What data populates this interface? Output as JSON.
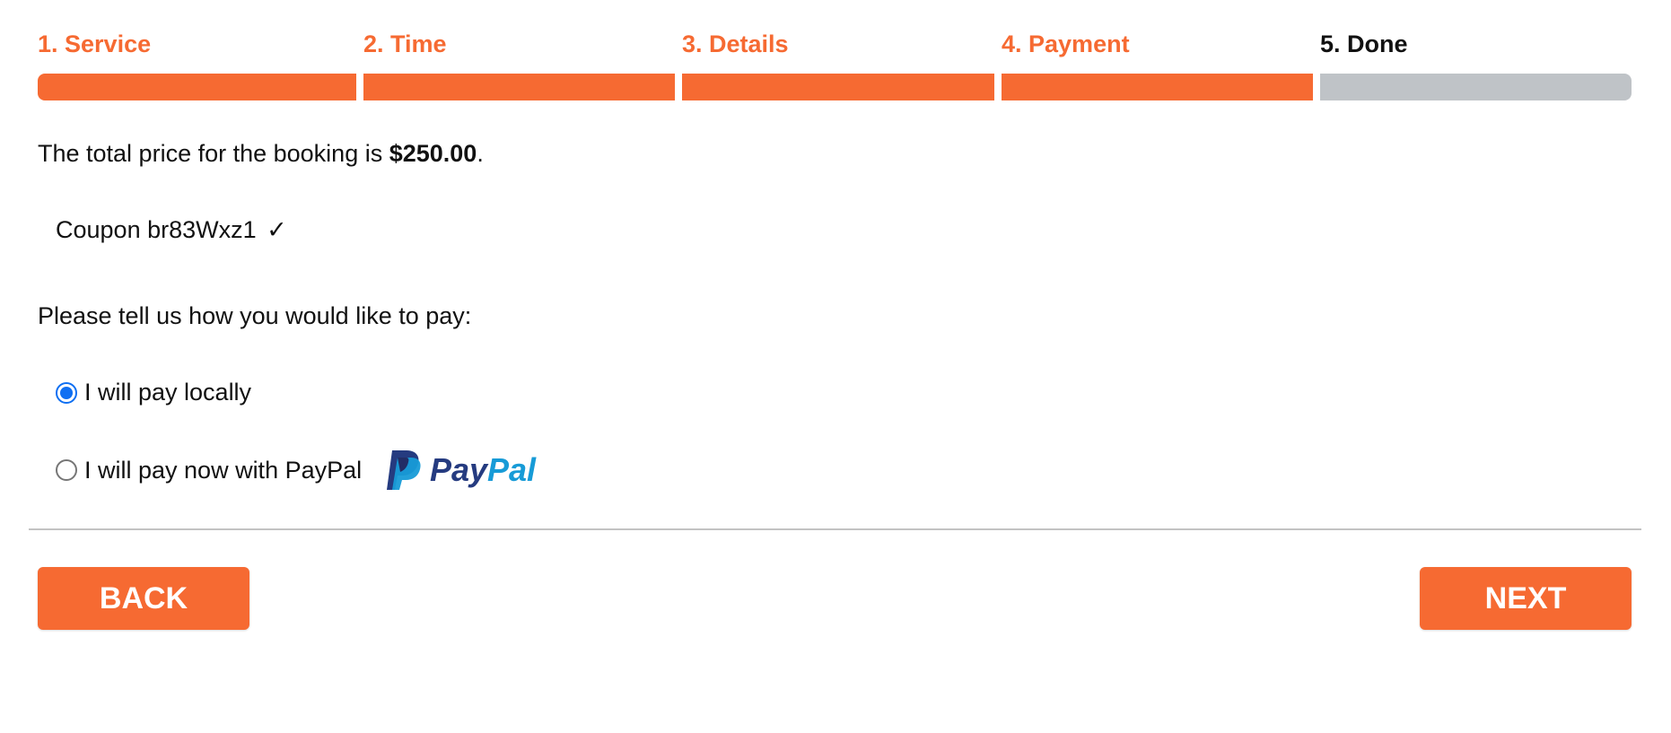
{
  "colors": {
    "accent": "#f66a32",
    "inactive_bar": "#bfc3c7",
    "done_label": "#111111",
    "radio_checked": "#0f6ff2",
    "paypal_dark": "#253b80",
    "paypal_light": "#179bd7"
  },
  "steps": [
    {
      "label": "1. Service",
      "state": "complete"
    },
    {
      "label": "2. Time",
      "state": "complete"
    },
    {
      "label": "3. Details",
      "state": "complete"
    },
    {
      "label": "4. Payment",
      "state": "complete"
    },
    {
      "label": "5. Done",
      "state": "pending"
    }
  ],
  "price": {
    "prefix": "The total price for the booking is ",
    "amount": "$250.00",
    "suffix": "."
  },
  "coupon": {
    "text": "Coupon br83Wxz1",
    "check": "✓"
  },
  "payment": {
    "prompt": "Please tell us how you would like to pay:",
    "options": [
      {
        "label": "I will pay locally",
        "checked": true
      },
      {
        "label": "I will pay now with PayPal",
        "checked": false,
        "logo": {
          "icon": "paypal-icon",
          "pay": "Pay",
          "pal": "Pal"
        }
      }
    ]
  },
  "buttons": {
    "back": "BACK",
    "next": "NEXT"
  }
}
